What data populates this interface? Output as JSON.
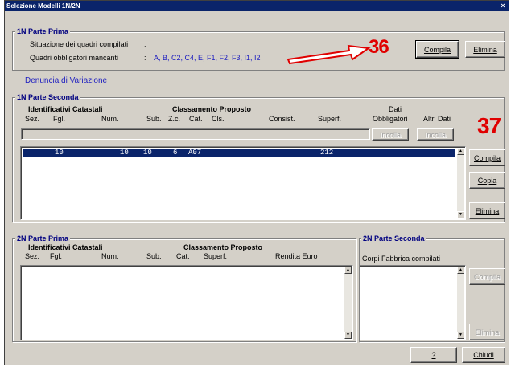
{
  "window": {
    "title": "Selezione Modelli 1N/2N",
    "close_glyph": "×"
  },
  "parte_prima_1n": {
    "title": "1N Parte Prima",
    "situazione_label": "Situazione dei quadri compilati",
    "situazione_sep": ":",
    "mancanti_label": "Quadri obbligatori mancanti",
    "mancanti_sep": ":",
    "mancanti_value": "A, B, C2, C4, E, F1, F2, F3, I1, I2",
    "annotation": "36",
    "compila_label": "Compila",
    "elimina_label": "Elimina"
  },
  "denuncia": "Denuncia di Variazione",
  "parte_seconda_1n": {
    "title": "1N Parte Seconda",
    "hdr_identificativi": "Identificativi Catastali",
    "hdr_classamento": "Classamento Proposto",
    "hdr_dati": "Dati",
    "columns": [
      "Sez.",
      "Fgl.",
      "Num.",
      "Sub.",
      "Z.c.",
      "Cat.",
      "Cls.",
      "Consist.",
      "Superf.",
      "Obbligatori",
      "Altri Dati"
    ],
    "incolla1": "Incolla",
    "incolla2": "Incolla",
    "annotation": "37",
    "row": {
      "fgl": "10",
      "num": "10",
      "sub": "10",
      "zc": "6",
      "cat": "A07",
      "superf": "212"
    },
    "compila_label": "Compila",
    "copia_label": "Copia",
    "elimina_label": "Elimina"
  },
  "parte_prima_2n": {
    "title": "2N Parte Prima",
    "hdr_identificativi": "Identificativi Catastali",
    "hdr_classamento": "Classamento Proposto",
    "columns": [
      "Sez.",
      "Fgl.",
      "Num.",
      "Sub.",
      "Cat.",
      "Superf.",
      "Rendita Euro"
    ]
  },
  "parte_seconda_2n": {
    "title": "2N Parte Seconda",
    "corpi_label": "Corpi Fabbrica compilati",
    "compila_label": "Compila",
    "elimina_label": "Elimina"
  },
  "footer": {
    "help_label": "?",
    "chiudi_label": "Chiudi"
  },
  "colors": {
    "title_bar": "#0a246a",
    "annotation": "#e00000",
    "label_blue": "#2020c0"
  }
}
